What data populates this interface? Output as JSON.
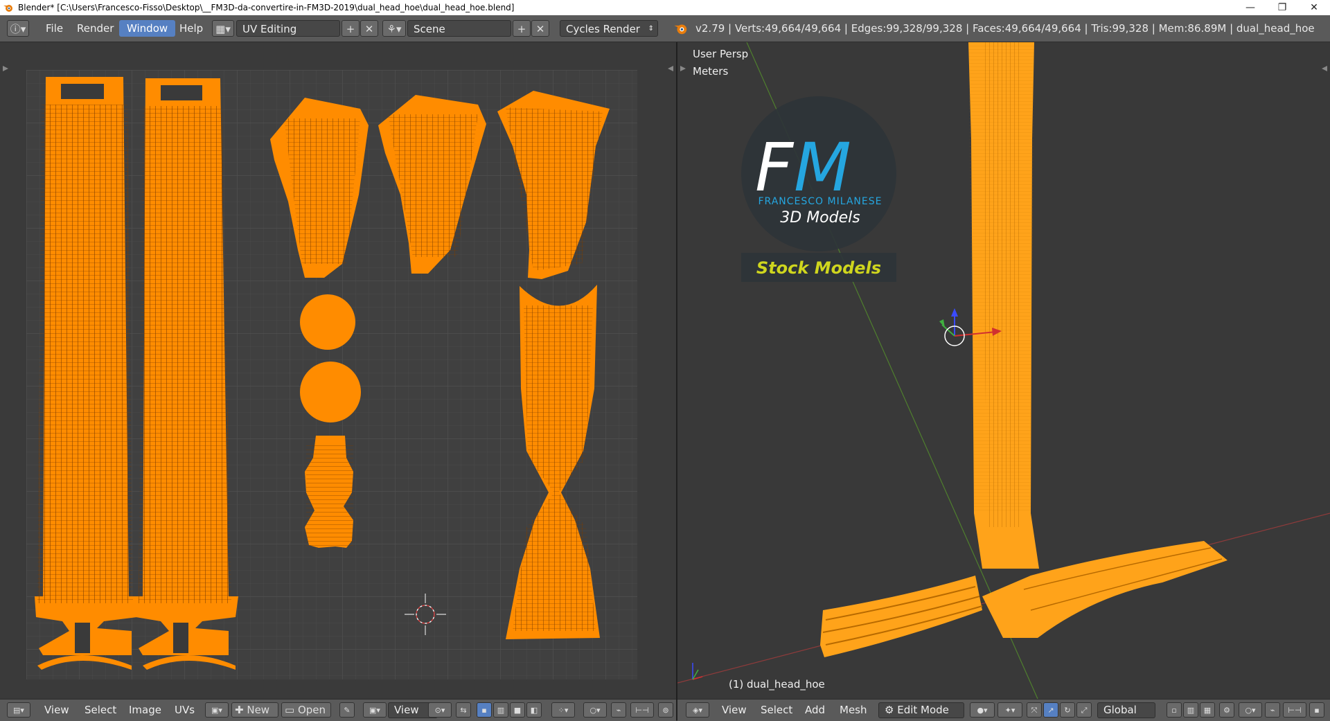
{
  "window": {
    "title": "Blender* [C:\\Users\\Francesco-Fisso\\Desktop\\__FM3D-da-convertire-in-FM3D-2019\\dual_head_hoe\\dual_head_hoe.blend]",
    "controls": [
      "—",
      "❐",
      "✕"
    ]
  },
  "topbar": {
    "menus": [
      "File",
      "Render",
      "Window",
      "Help"
    ],
    "active_menu": "Window",
    "screen_layout": "UV Editing",
    "scene": "Scene",
    "render_engine": "Cycles Render",
    "stats": "v2.79 | Verts:49,664/49,664 | Edges:99,328/99,328 | Faces:49,664/49,664 | Tris:99,328 | Mem:86.89M | dual_head_hoe"
  },
  "viewport": {
    "view_name": "User Persp",
    "units": "Meters",
    "object_label": "(1) dual_head_hoe"
  },
  "watermark": {
    "logo_letters": "FM",
    "brand": "FRANCESCO MILANESE",
    "subtitle": "3D Models",
    "badge": "Stock Models"
  },
  "uv_header": {
    "menus": [
      "View",
      "Select",
      "Image",
      "UVs"
    ],
    "new_label": "New",
    "open_label": "Open",
    "view_label": "View"
  },
  "view3d_header": {
    "menus": [
      "View",
      "Select",
      "Add",
      "Mesh"
    ],
    "mode": "Edit Mode",
    "orientation": "Global"
  },
  "colors": {
    "uv_orange": "#ff8c00",
    "mesh_orange": "#ffa31a",
    "accent_blue": "#5680c2",
    "badge_text": "#cfd61e"
  }
}
